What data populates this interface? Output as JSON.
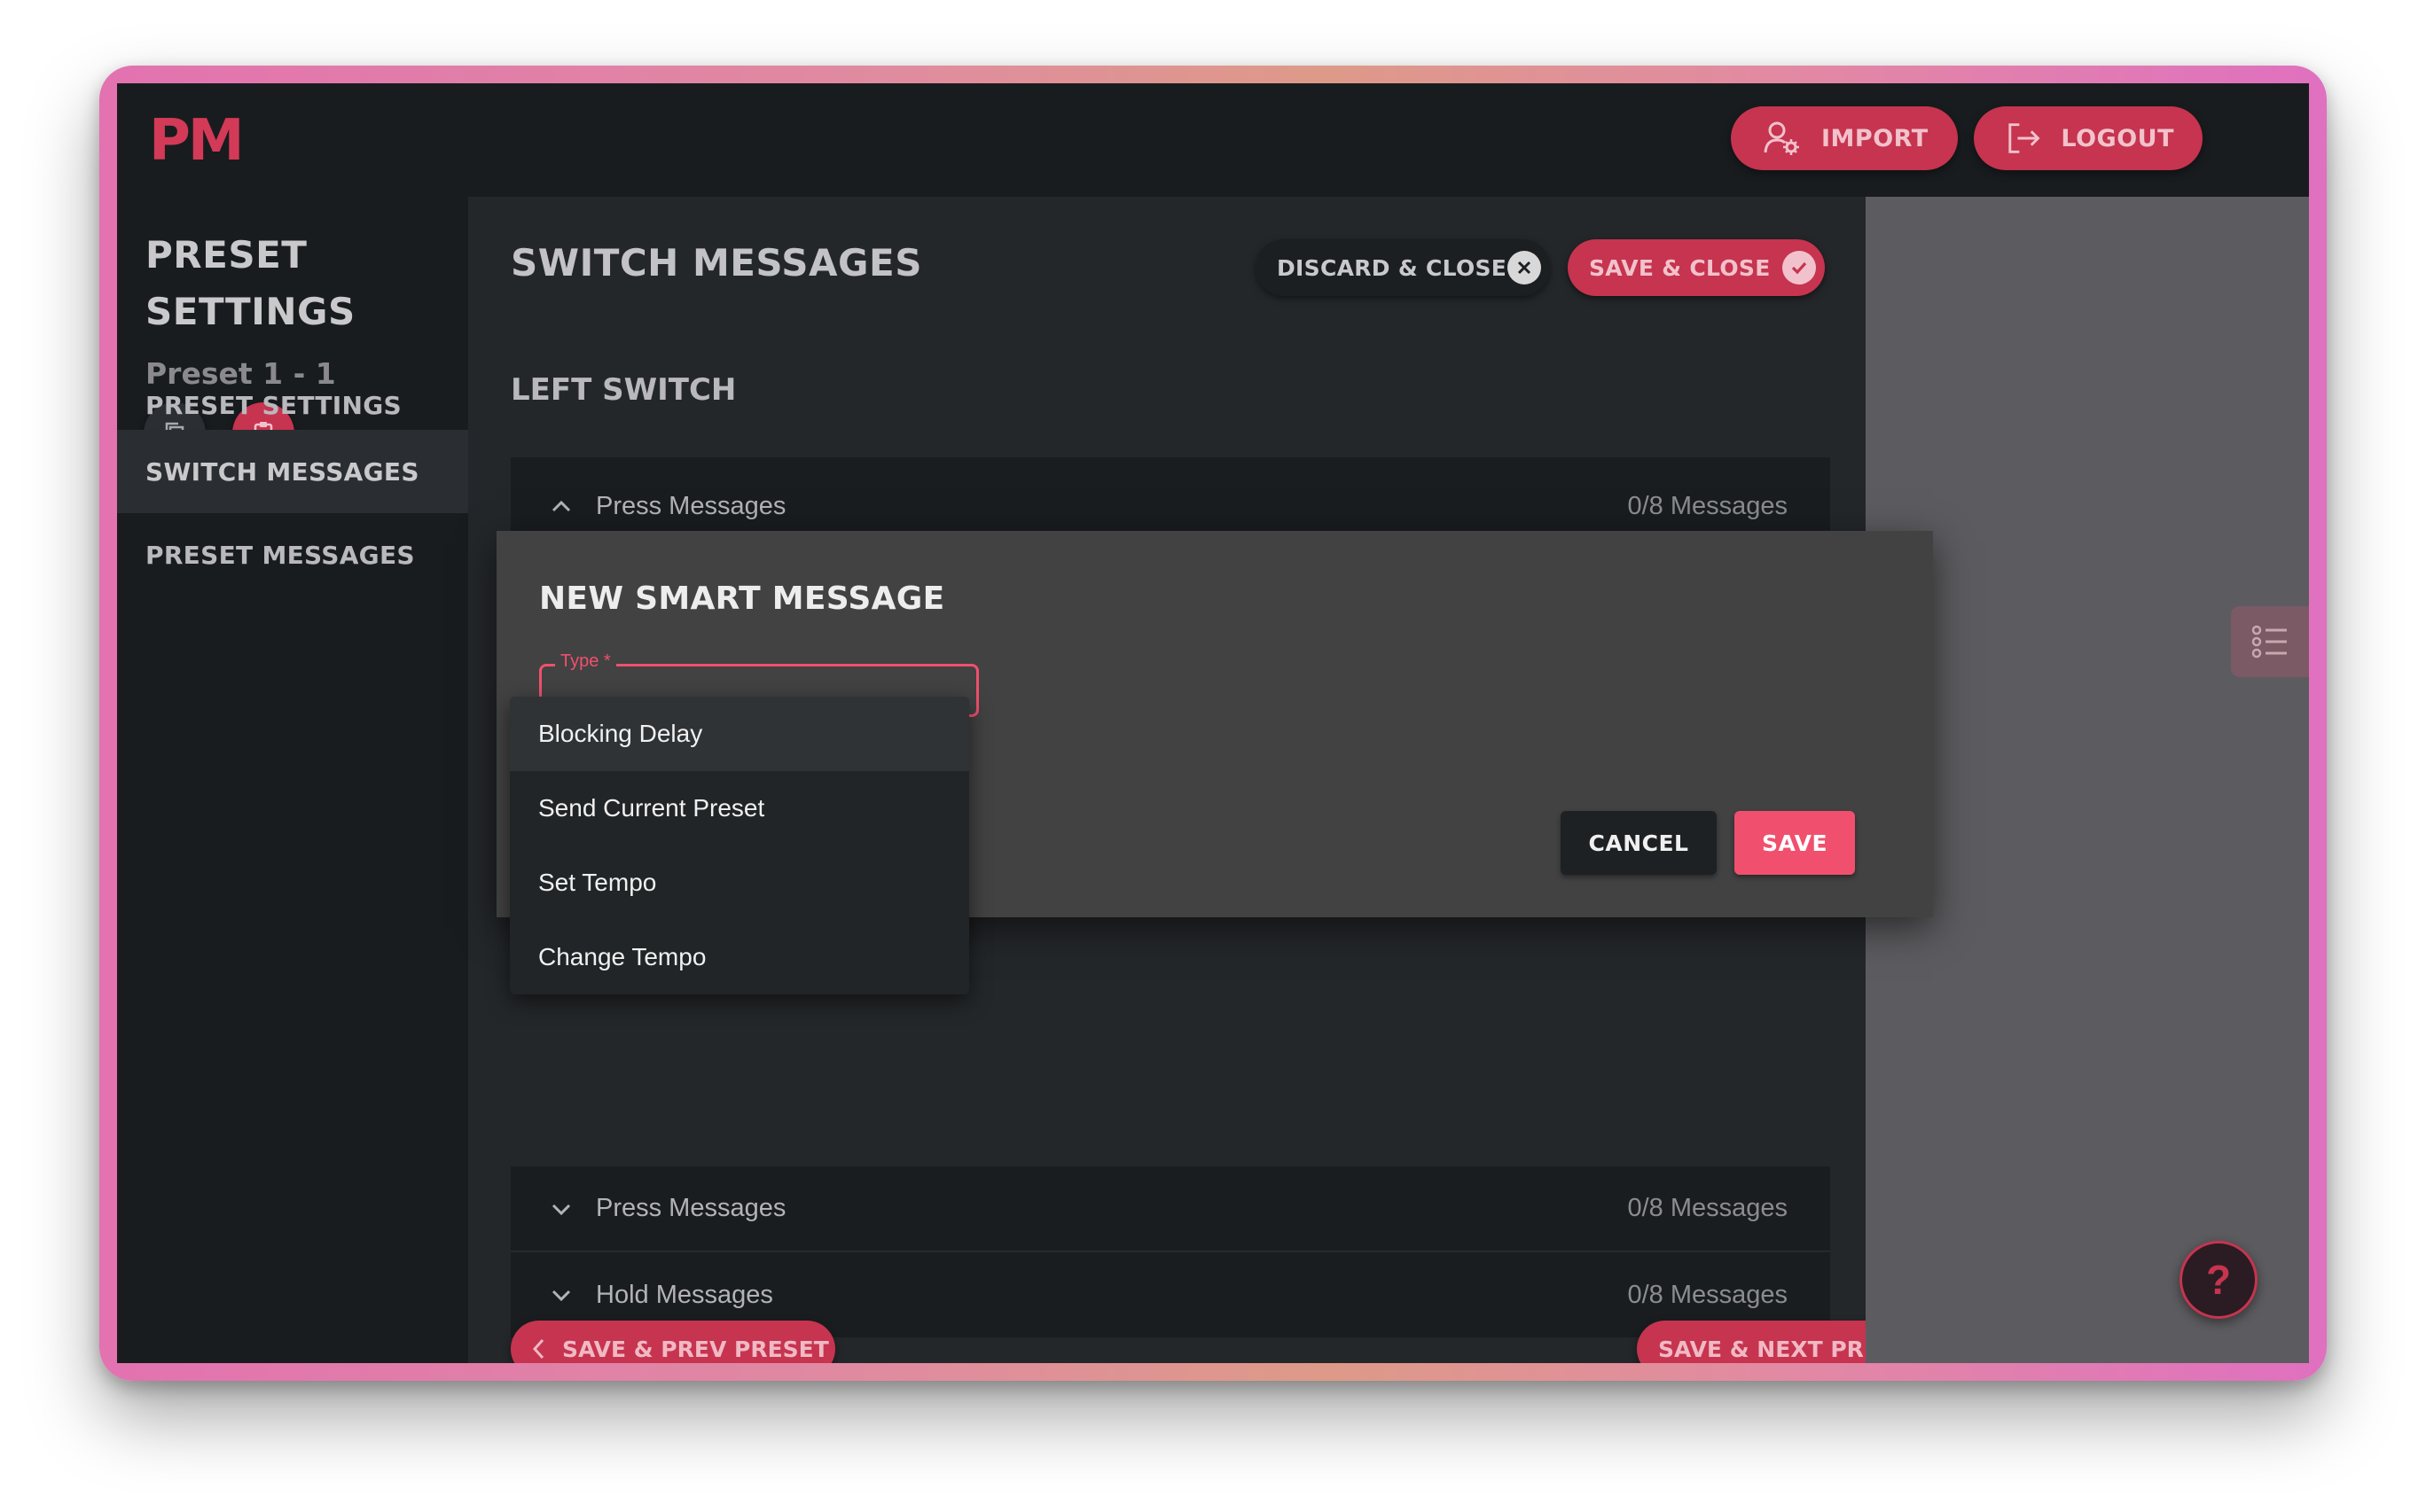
{
  "app": {
    "logo": "PM"
  },
  "header": {
    "import_label": "IMPORT",
    "logout_label": "LOGOUT"
  },
  "sidebar": {
    "title_line1": "PRESET",
    "title_line2": "SETTINGS",
    "preset_name": "Preset 1 - 1",
    "nav": [
      "PRESET SETTINGS",
      "SWITCH MESSAGES",
      "PRESET MESSAGES"
    ],
    "active_nav": "SWITCH MESSAGES"
  },
  "main": {
    "title": "SWITCH MESSAGES",
    "discard_label": "DISCARD & CLOSE",
    "save_close_label": "SAVE & CLOSE",
    "left_switch_title": "LEFT SWITCH",
    "left_press": {
      "label": "Press Messages",
      "count": "0/8 Messages"
    },
    "right_press": {
      "label": "Press Messages",
      "count": "0/8 Messages"
    },
    "right_hold": {
      "label": "Hold Messages",
      "count": "0/8 Messages"
    },
    "prev_label": "SAVE & PREV PRESET",
    "next_label": "SAVE & NEXT PRESET"
  },
  "dialog": {
    "title": "NEW SMART MESSAGE",
    "type_label": "Type *",
    "cancel_label": "CANCEL",
    "save_label": "SAVE",
    "options": [
      "Blocking Delay",
      "Send Current Preset",
      "Set Tempo",
      "Change Tempo"
    ],
    "highlighted_option": "Blocking Delay"
  },
  "help": {
    "label": "?"
  },
  "colors": {
    "accent": "#c6344f",
    "accent_bright": "#f0506e",
    "bg": "#191c1f",
    "panel": "#24272a"
  },
  "icons": [
    "user-settings-icon",
    "logout-icon",
    "copy-icon",
    "clipboard-icon",
    "close-circle-icon",
    "check-circle-icon",
    "chevron-up-icon",
    "chevron-down-icon",
    "chevron-left-icon",
    "chevron-right-icon",
    "list-icon",
    "help-icon"
  ]
}
